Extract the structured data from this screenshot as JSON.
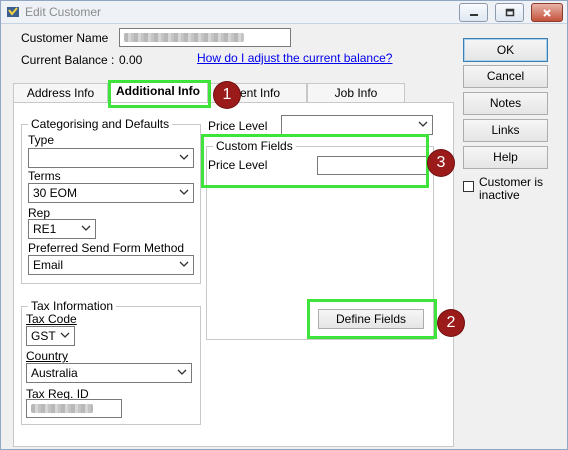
{
  "window": {
    "title": "Edit Customer",
    "icons": [
      "app-icon",
      "minimize-icon",
      "restore-icon",
      "close-icon"
    ]
  },
  "header": {
    "customer_name_label": "Customer Name",
    "current_balance_label": "Current Balance :",
    "current_balance_value": "0.00",
    "adjust_link": "How do I adjust the current balance?"
  },
  "tabs": [
    {
      "label": "Address Info"
    },
    {
      "label": "Additional Info"
    },
    {
      "label": "rment Info"
    },
    {
      "label": "Job Info"
    }
  ],
  "categorising": {
    "legend": "Categorising and Defaults",
    "type_label": "Type",
    "type_value": "",
    "terms_label": "Terms",
    "terms_value": "30 EOM",
    "rep_label": "Rep",
    "rep_value": "RE1",
    "send_method_label": "Preferred Send Form Method",
    "send_method_value": "Email"
  },
  "tax": {
    "legend": "Tax Information",
    "tax_code_label": "Tax Code",
    "tax_code_value": "GST",
    "country_label": "Country",
    "country_value": "Australia",
    "tax_reg_label": "Tax Reg. ID"
  },
  "price_level": {
    "label": "Price Level",
    "value": ""
  },
  "custom_fields": {
    "legend": "Custom Fields",
    "price_level_label": "Price Level",
    "price_level_value": "",
    "define_fields_label": "Define Fields"
  },
  "buttons": {
    "ok": "OK",
    "cancel": "Cancel",
    "notes": "Notes",
    "links": "Links",
    "help": "Help"
  },
  "inactive": {
    "label_line1": "Customer is",
    "label_line2": "inactive",
    "checked": false
  },
  "annotations": [
    {
      "number": "1"
    },
    {
      "number": "2"
    },
    {
      "number": "3"
    }
  ],
  "colors": {
    "highlight": "#3ee43a",
    "badge": "#9b1b1b",
    "link": "#0000ee"
  }
}
